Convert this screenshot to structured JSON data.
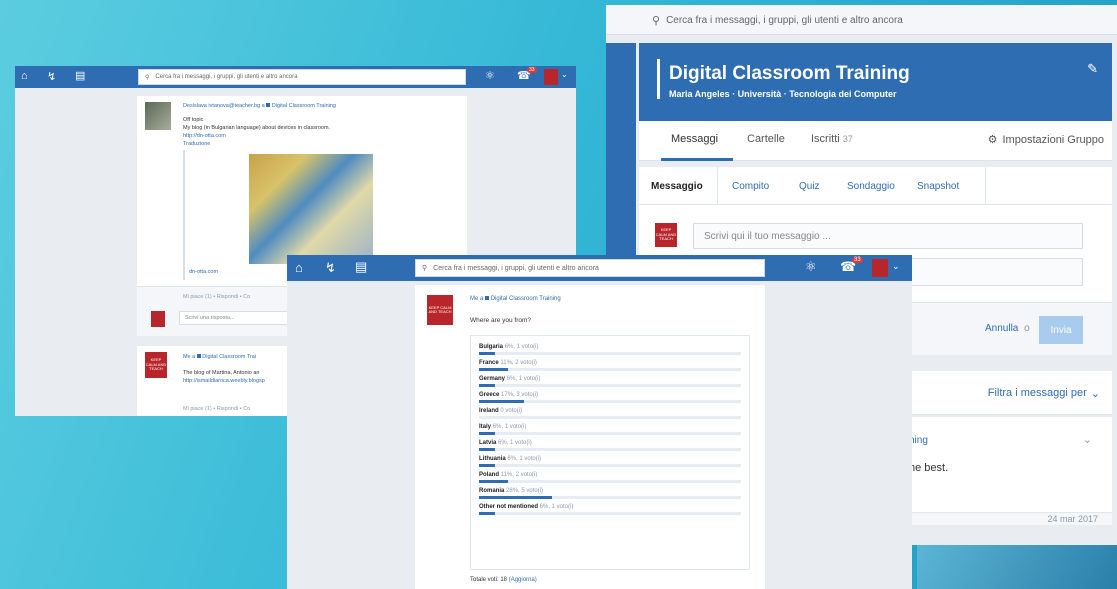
{
  "colors": {
    "brand": "#2f6db3",
    "avatar": "#b8262c",
    "background": "#34b8d6"
  },
  "right_panel": {
    "search_placeholder": "Cerca fra i messaggi, i gruppi, gli utenti e altro ancora",
    "group_title": "Digital Classroom Training",
    "group_subtitle": "Maria Angeles · Università · Tecnologia dei Computer",
    "tabs": [
      {
        "label": "Messaggi",
        "active": true
      },
      {
        "label": "Cartelle",
        "active": false
      },
      {
        "label": "Iscritti",
        "count": "37",
        "active": false
      }
    ],
    "settings_label": "Impostazioni Gruppo",
    "composer_tabs": [
      "Messaggio",
      "Compito",
      "Quiz",
      "Sondaggio",
      "Snapshot"
    ],
    "composer_placeholder": "Scrivi qui il tuo messaggio ...",
    "cancel_label": "Annulla",
    "or_label": "o",
    "send_label": "Invia",
    "filter_label": "Filtra i messaggi per",
    "fragment_ning": "ning",
    "fragment_best": "he best.",
    "fragment_date": "24 mar 2017"
  },
  "left_panel": {
    "search_placeholder": "Cerca fra i messaggi, i gruppi, gli utenti e altro ancora",
    "badge": "33",
    "post1": {
      "author": "Desislava ivtanova@teacher.bg a",
      "group": "Digital Classroom Training",
      "line1": "Off topic",
      "line2": "My blog (in Bulgarian language) about devices in classroom.",
      "link": "http://dn-otta.com",
      "translate": "Traduzione",
      "preview_domain": "dn-otta.com",
      "actions": "Mi piace (1) • Rispondi • Co",
      "reply_placeholder": "Scrivi una risposta..."
    },
    "post2": {
      "author": "Me a",
      "group": "Digital Classroom Trai",
      "line1": "The blog of Martina, Antonio an",
      "link": "http://ismaildiaroca.weebly.blogsp",
      "actions": "Mi piace (1) • Rispondi • Co"
    },
    "avatar_text": "KEEP CALM AND TEACH"
  },
  "middle_panel": {
    "search_placeholder": "Cerca fra i messaggi, i gruppi, gli utenti e altro ancora",
    "badge": "33",
    "author": "Me a",
    "group": "Digital Classroom Training",
    "question": "Where are you from?",
    "poll": [
      {
        "name": "Bulgaria",
        "stats": "6%, 1 voto(i)",
        "pct": 6
      },
      {
        "name": "France",
        "stats": "11%, 2 voto(i)",
        "pct": 11
      },
      {
        "name": "Germany",
        "stats": "6%, 1 voto(i)",
        "pct": 6
      },
      {
        "name": "Greece",
        "stats": "17%, 3 voto(i)",
        "pct": 17
      },
      {
        "name": "Ireland",
        "stats": "0 voto(i)",
        "pct": 0
      },
      {
        "name": "Italy",
        "stats": "6%, 1 voto(i)",
        "pct": 6
      },
      {
        "name": "Latvia",
        "stats": "6%, 1 voto(i)",
        "pct": 6
      },
      {
        "name": "Lithuania",
        "stats": "6%, 1 voto(i)",
        "pct": 6
      },
      {
        "name": "Poland",
        "stats": "11%, 2 voto(i)",
        "pct": 11
      },
      {
        "name": "Romania",
        "stats": "28%, 5 voto(i)",
        "pct": 28
      },
      {
        "name": "Other not mentioned",
        "stats": "6%, 1 voto(i)",
        "pct": 6
      }
    ],
    "total_label": "Totale voti: 18",
    "refresh_label": "(Aggiorna)"
  }
}
